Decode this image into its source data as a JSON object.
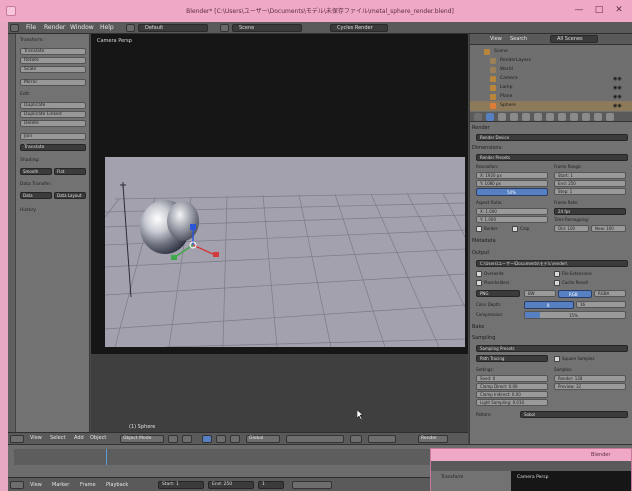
{
  "window": {
    "title": "Blender* [C:\\Users\\ユーザー\\Documents\\モデル\\未保存ファイル\\metal_sphere_render.blend]",
    "minimize": "—",
    "maximize": "□",
    "close": "✕"
  },
  "info_header": {
    "menus": [
      "File",
      "Render",
      "Window",
      "Help"
    ],
    "layout": "Default",
    "scene": "Scene",
    "engine": "Cycles Render"
  },
  "tool_shelf": {
    "transform_title": "Transform:",
    "buttons": [
      "Translate",
      "Rotate",
      "Scale",
      "Mirror"
    ],
    "edit_title": "Edit:",
    "edit_buttons": [
      "Duplicate",
      "Duplicate Linked",
      "Delete",
      "Join"
    ],
    "shading_title": "Shading:",
    "shading_buttons": [
      "Smooth",
      "Flat"
    ],
    "data_title": "Data Transfer:",
    "data_buttons": [
      "Data",
      "Data Layout"
    ],
    "history_title": "History",
    "last_op": "Translate"
  },
  "viewport": {
    "camera_label": "Camera Persp",
    "bottom_label": "(1) Sphere"
  },
  "viewport_header": {
    "menus": [
      "View",
      "Select",
      "Add",
      "Object"
    ],
    "mode": "Object Mode",
    "pivot": "Global",
    "extra": "Render"
  },
  "outliner": {
    "header_items": [
      "View",
      "Search",
      "All Scenes"
    ],
    "rows": [
      {
        "label": "Scene",
        "color": "#b8863b"
      },
      {
        "label": "RenderLayers",
        "color": "#9b7f58"
      },
      {
        "label": "World",
        "color": "#9b7f58"
      },
      {
        "label": "Camera",
        "color": "#b8863b"
      },
      {
        "label": "Lamp",
        "color": "#b8863b"
      },
      {
        "label": "Plane",
        "color": "#b8863b"
      },
      {
        "label": "Sphere",
        "color": "#e07b36"
      }
    ]
  },
  "properties": {
    "render_title": "Render",
    "device": "Render Device",
    "dimensions_title": "Dimensions:",
    "dimensions_preset": "Render Presets",
    "resolution_label": "Resolution:",
    "res_x": "X: 1920 px",
    "res_y": "Y: 1080 px",
    "res_pct": "50%",
    "frame_range": "Frame Range:",
    "start": "Start: 1",
    "end": "End: 250",
    "step": "Step: 1",
    "aspect": "Aspect Ratio:",
    "asp_x": "X: 1.000",
    "asp_y": "Y: 1.000",
    "frame_rate": "Frame Rate:",
    "fps": "24 fps",
    "border": "Border",
    "crop": "Crop",
    "time_remap": "Time Remapping:",
    "old": "Old: 100",
    "new": "New: 100",
    "metadata_title": "Metadata",
    "output_title": "Output",
    "output_path": "C:\\Users\\ユーザー\\Documents\\モデル\\render\\",
    "overwrite": "Overwrite",
    "placeholders": "Placeholders",
    "file_ext": "File Extensions",
    "cache": "Cache Result",
    "format": "PNG",
    "bw": "BW",
    "rgb": "RGB",
    "rgba": "RGBA",
    "color_depth": "Color Depth:",
    "depth_8": "8",
    "depth_16": "16",
    "compression": "Compression:",
    "compression_val": "15%",
    "bake_title": "Bake",
    "sampling_title": "Sampling",
    "sampling_preset": "Sampling Presets",
    "path_tracing": "Path Tracing",
    "square_samples": "Square Samples",
    "settings": "Settings:",
    "samples": "Samples:",
    "seed": "Seed: 0",
    "clamp_direct": "Clamp Direct: 0.00",
    "clamp_indirect": "Clamp Indirect: 0.00",
    "light_threshold": "Light Sampling: 0.010",
    "render_samples": "Render: 128",
    "preview_samples": "Preview: 32",
    "pattern": "Pattern:",
    "pattern_val": "Sobol"
  },
  "timeline": {
    "menus": [
      "View",
      "Marker",
      "Frame",
      "Playback"
    ],
    "start": "Start: 1",
    "end": "End: 250",
    "current": "1"
  },
  "second_window": {
    "title": "Blender",
    "label": "Camera Persp",
    "tool": "Transform"
  }
}
